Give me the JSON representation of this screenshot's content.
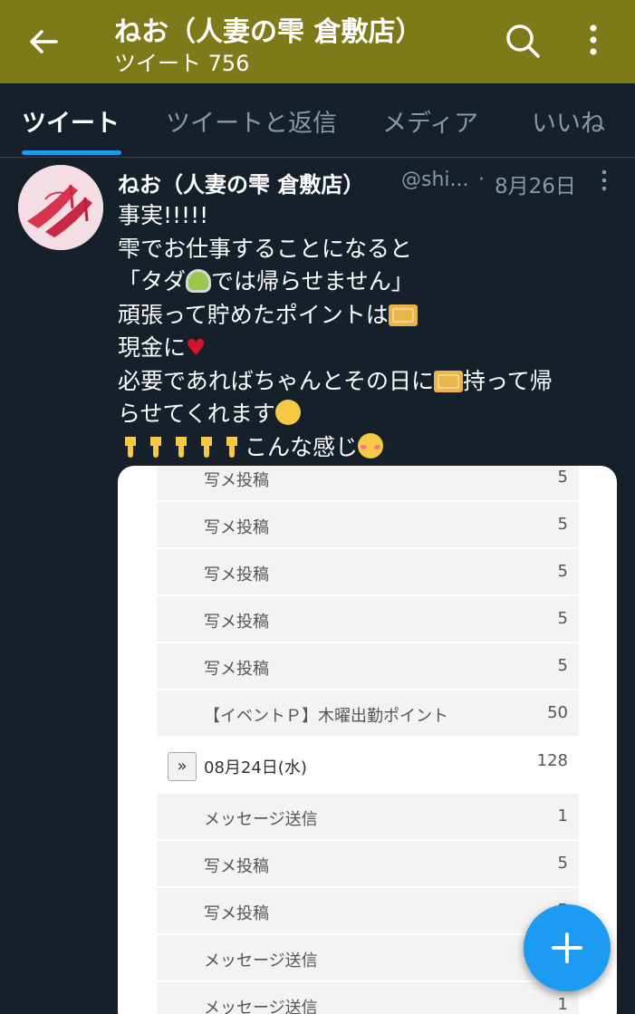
{
  "header": {
    "title": "ねお（人妻の雫 倉敷店）",
    "subtitle": "ツイート 756"
  },
  "tabs": [
    {
      "label": "ツイート"
    },
    {
      "label": "ツイートと返信"
    },
    {
      "label": "メディア"
    },
    {
      "label": "いいね"
    }
  ],
  "tweet": {
    "author": "ねお（人妻の雫 倉敷店）",
    "handle": "@shi...",
    "separator": "·",
    "date": "8月26日",
    "lines": {
      "l1": "事実!!!!!",
      "l2": "雫でお仕事することになると",
      "l3a": "「タダ",
      "l3b": "では帰らせません」",
      "l4": "頑張って貯めたポイントは",
      "l5": "現金に",
      "heart": "♥",
      "l6a": "必要であればちゃんとその日に",
      "l6b": "持って帰",
      "l7": "らせてくれます",
      "l8": "こんな感じ"
    }
  },
  "points_table": {
    "rows": [
      {
        "label": "写メ投稿",
        "value": "5"
      },
      {
        "label": "写メ投稿",
        "value": "5"
      },
      {
        "label": "写メ投稿",
        "value": "5"
      },
      {
        "label": "写メ投稿",
        "value": "5"
      },
      {
        "label": "写メ投稿",
        "value": "5"
      },
      {
        "label": "【イベントＰ】木曜出勤ポイント",
        "value": "50"
      }
    ],
    "date_row": {
      "expand_label": "»",
      "label": "08月24日(水)",
      "value": "128"
    },
    "rows_after": [
      {
        "label": "メッセージ送信",
        "value": "1"
      },
      {
        "label": "写メ投稿",
        "value": "5"
      },
      {
        "label": "写メ投稿",
        "value": "5"
      },
      {
        "label": "メッセージ送信",
        "value": "1"
      },
      {
        "label": "メッセージ送信",
        "value": "1"
      }
    ]
  },
  "colors": {
    "header_bg": "#7e7a1a",
    "page_bg": "#15202b",
    "accent": "#1d9bf0",
    "muted": "#8899a6"
  },
  "icons": {
    "back": "arrow-left-icon",
    "search": "search-icon",
    "more": "more-vertical-icon",
    "compose": "plus-icon"
  }
}
